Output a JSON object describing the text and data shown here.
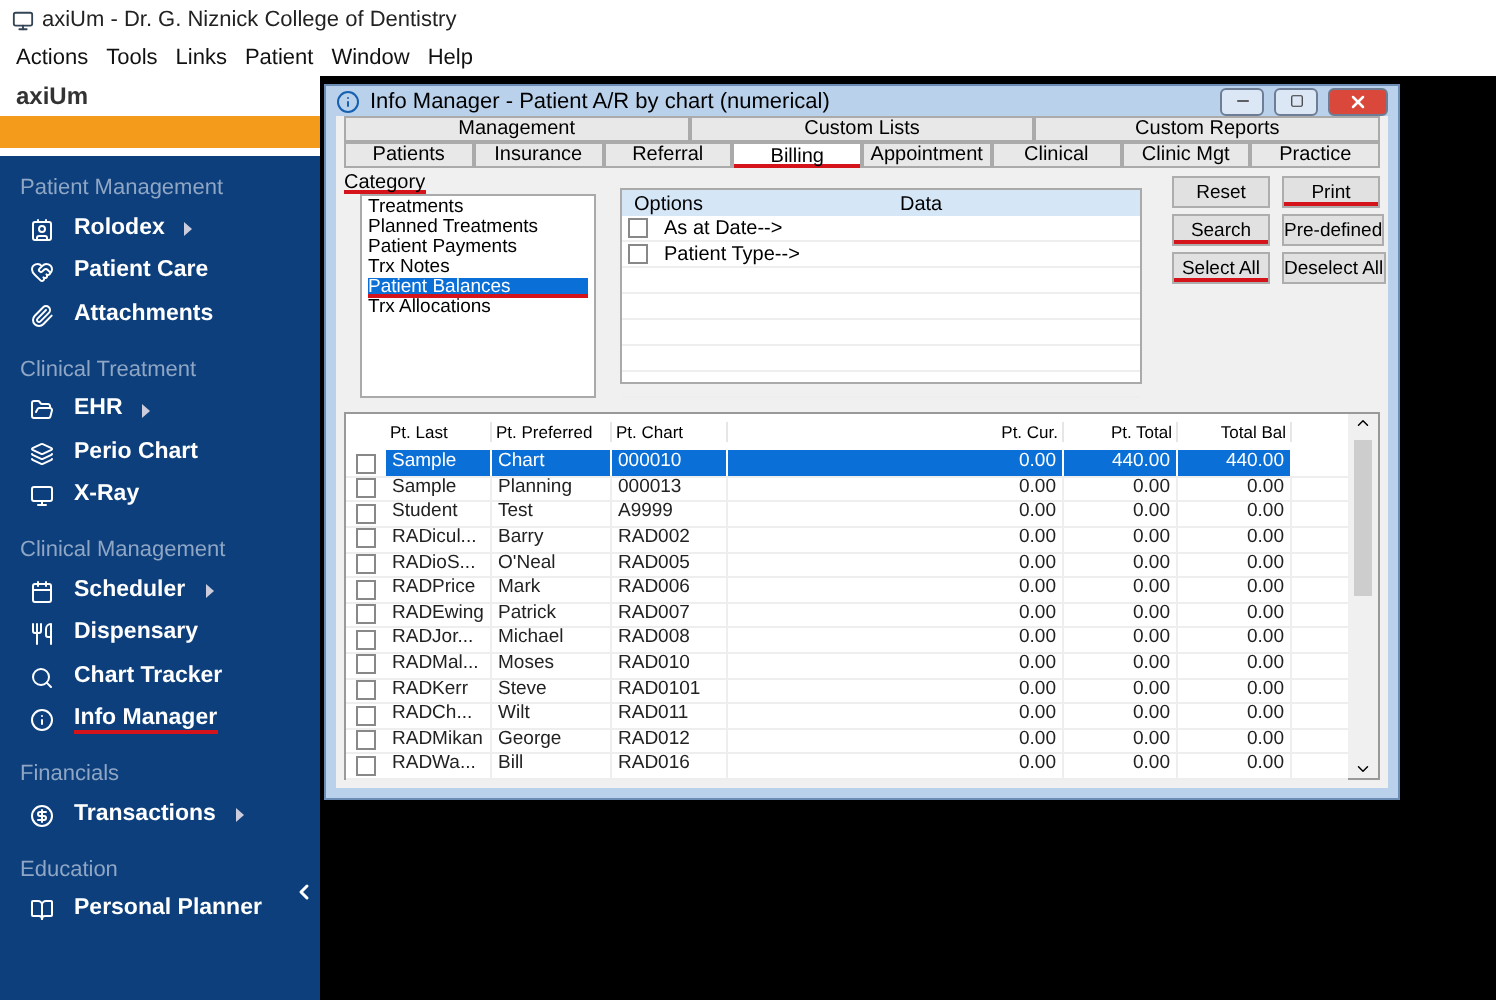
{
  "window": {
    "title": "axiUm - Dr. G. Niznick College of Dentistry"
  },
  "menu": [
    "Actions",
    "Tools",
    "Links",
    "Patient",
    "Window",
    "Help"
  ],
  "sidebar": {
    "logo": "axiUm",
    "sections": [
      {
        "title": "Patient Management",
        "items": [
          {
            "label": "Rolodex",
            "submenu": true,
            "underlined": false
          },
          {
            "label": "Patient Care",
            "submenu": false,
            "underlined": false
          },
          {
            "label": "Attachments",
            "submenu": false,
            "underlined": false
          }
        ]
      },
      {
        "title": "Clinical Treatment",
        "items": [
          {
            "label": "EHR",
            "submenu": true,
            "underlined": false
          },
          {
            "label": "Perio Chart",
            "submenu": false,
            "underlined": false
          },
          {
            "label": "X-Ray",
            "submenu": false,
            "underlined": false
          }
        ]
      },
      {
        "title": "Clinical Management",
        "items": [
          {
            "label": "Scheduler",
            "submenu": true,
            "underlined": false
          },
          {
            "label": "Dispensary",
            "submenu": false,
            "underlined": false
          },
          {
            "label": "Chart Tracker",
            "submenu": false,
            "underlined": false
          },
          {
            "label": "Info Manager",
            "submenu": false,
            "underlined": true
          }
        ]
      },
      {
        "title": "Financials",
        "items": [
          {
            "label": "Transactions",
            "submenu": true,
            "underlined": false
          }
        ]
      },
      {
        "title": "Education",
        "items": [
          {
            "label": "Personal Planner",
            "submenu": false,
            "underlined": false
          }
        ]
      }
    ]
  },
  "dialog": {
    "title": "Info Manager - Patient A/R by chart (numerical)",
    "tabs_top": [
      {
        "label": "Management",
        "selected": false
      },
      {
        "label": "Custom Lists",
        "selected": false
      },
      {
        "label": "Custom Reports",
        "selected": false
      }
    ],
    "tabs": [
      {
        "label": "Patients",
        "selected": false,
        "underlined": false
      },
      {
        "label": "Insurance",
        "selected": false,
        "underlined": false
      },
      {
        "label": "Referral",
        "selected": false,
        "underlined": false
      },
      {
        "label": "Billing",
        "selected": true,
        "underlined": true
      },
      {
        "label": "Appointment",
        "selected": false,
        "underlined": false
      },
      {
        "label": "Clinical",
        "selected": false,
        "underlined": false
      },
      {
        "label": "Clinic Mgt",
        "selected": false,
        "underlined": false
      },
      {
        "label": "Practice",
        "selected": false,
        "underlined": false
      }
    ],
    "category": {
      "label": "Category",
      "underlined": true,
      "items": [
        {
          "label": "Treatments",
          "selected": false,
          "underlined": false
        },
        {
          "label": "Planned Treatments",
          "selected": false,
          "underlined": false
        },
        {
          "label": "Patient Payments",
          "selected": false,
          "underlined": false
        },
        {
          "label": "Trx Notes",
          "selected": false,
          "underlined": false
        },
        {
          "label": "Patient Balances",
          "selected": true,
          "underlined": true
        },
        {
          "label": "Trx Allocations",
          "selected": false,
          "underlined": false
        }
      ]
    },
    "options": {
      "columns": [
        "Options",
        "Data"
      ],
      "rows": [
        {
          "label": "As at Date-->",
          "checked": false
        },
        {
          "label": "Patient Type-->",
          "checked": false
        }
      ]
    },
    "buttons": [
      {
        "label": "Reset",
        "underlined": false
      },
      {
        "label": "Print",
        "underlined": true
      },
      {
        "label": "Search",
        "underlined": true
      },
      {
        "label": "Pre-defined",
        "underlined": false
      },
      {
        "label": "Select All",
        "underlined": true
      },
      {
        "label": "Deselect All",
        "underlined": false
      }
    ],
    "table": {
      "columns": [
        "Pt. Last",
        "Pt. Preferred",
        "Pt. Chart",
        "Pt. Cur.",
        "Pt. Total",
        "Total Bal"
      ],
      "rows": [
        {
          "selected": true,
          "checked": false,
          "cells": [
            "Sample",
            "Chart",
            "000010",
            "0.00",
            "440.00",
            "440.00"
          ]
        },
        {
          "selected": false,
          "checked": false,
          "cells": [
            "Sample",
            "Planning",
            "000013",
            "0.00",
            "0.00",
            "0.00"
          ]
        },
        {
          "selected": false,
          "checked": false,
          "cells": [
            "Student",
            "Test",
            "A9999",
            "0.00",
            "0.00",
            "0.00"
          ]
        },
        {
          "selected": false,
          "checked": false,
          "cells": [
            "RADicul...",
            "Barry",
            "RAD002",
            "0.00",
            "0.00",
            "0.00"
          ]
        },
        {
          "selected": false,
          "checked": false,
          "cells": [
            "RADioS...",
            "O'Neal",
            "RAD005",
            "0.00",
            "0.00",
            "0.00"
          ]
        },
        {
          "selected": false,
          "checked": false,
          "cells": [
            "RADPrice",
            "Mark",
            "RAD006",
            "0.00",
            "0.00",
            "0.00"
          ]
        },
        {
          "selected": false,
          "checked": false,
          "cells": [
            "RADEwing",
            "Patrick",
            "RAD007",
            "0.00",
            "0.00",
            "0.00"
          ]
        },
        {
          "selected": false,
          "checked": false,
          "cells": [
            "RADJor...",
            "Michael",
            "RAD008",
            "0.00",
            "0.00",
            "0.00"
          ]
        },
        {
          "selected": false,
          "checked": false,
          "cells": [
            "RADMal...",
            "Moses",
            "RAD010",
            "0.00",
            "0.00",
            "0.00"
          ]
        },
        {
          "selected": false,
          "checked": false,
          "cells": [
            "RADKerr",
            "Steve",
            "RAD0101",
            "0.00",
            "0.00",
            "0.00"
          ]
        },
        {
          "selected": false,
          "checked": false,
          "cells": [
            "RADCh...",
            "Wilt",
            "RAD011",
            "0.00",
            "0.00",
            "0.00"
          ]
        },
        {
          "selected": false,
          "checked": false,
          "cells": [
            "RADMikan",
            "George",
            "RAD012",
            "0.00",
            "0.00",
            "0.00"
          ]
        },
        {
          "selected": false,
          "checked": false,
          "cells": [
            "RADWa...",
            "Bill",
            "RAD016",
            "0.00",
            "0.00",
            "0.00"
          ]
        }
      ]
    }
  }
}
